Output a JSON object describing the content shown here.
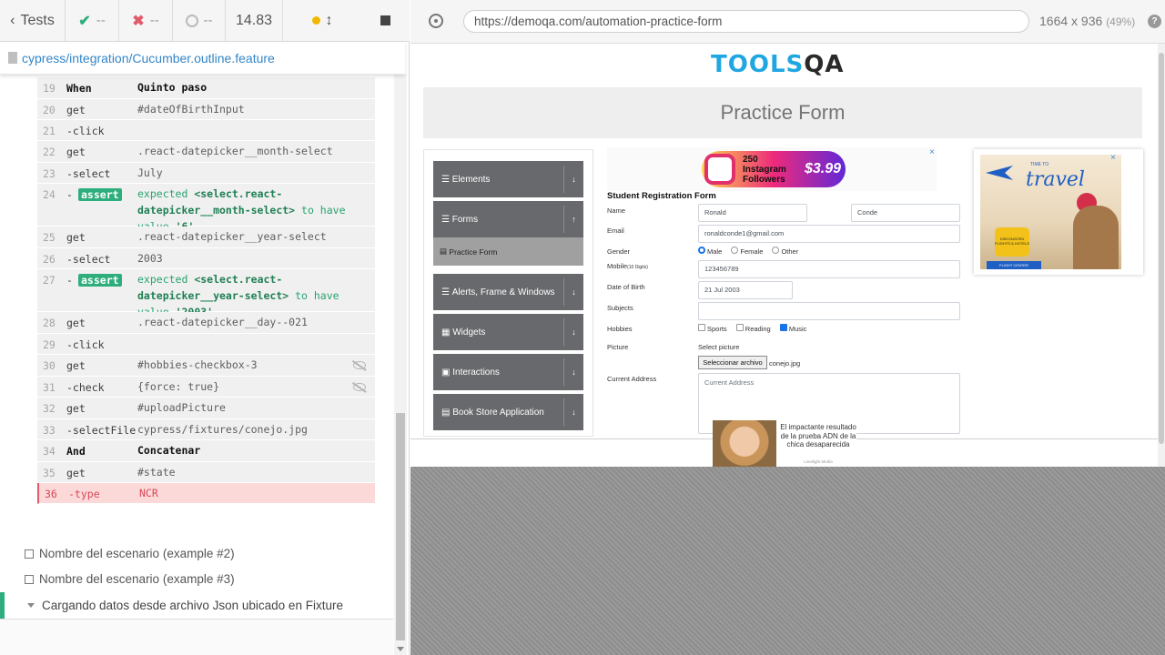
{
  "reporter": {
    "header": {
      "back_label": "Tests",
      "passed": "--",
      "failed": "--",
      "pending": "--",
      "duration": "14.83"
    },
    "file_path": "cypress/integration/Cucumber.outline.feature",
    "commands": [
      {
        "num": "19",
        "name": "When",
        "msg": "Quinto paso",
        "type": "step"
      },
      {
        "num": "20",
        "name": "get",
        "msg": "#dateOfBirthInput"
      },
      {
        "num": "21",
        "name": "-click",
        "msg": ""
      },
      {
        "num": "22",
        "name": "get",
        "msg": ".react-datepicker__month-select"
      },
      {
        "num": "23",
        "name": "-select",
        "msg": "July"
      },
      {
        "num": "24",
        "name": "-",
        "badge": "assert",
        "assert": {
          "pre": "expected",
          "subject": "<select.react-datepicker__month-select>",
          "mid": "to have value",
          "value": "'6'"
        }
      },
      {
        "num": "25",
        "name": "get",
        "msg": ".react-datepicker__year-select"
      },
      {
        "num": "26",
        "name": "-select",
        "msg": "2003"
      },
      {
        "num": "27",
        "name": "-",
        "badge": "assert",
        "assert": {
          "pre": "expected",
          "subject": "<select.react-datepicker__year-select>",
          "mid": "to have value",
          "value": "'2003'"
        }
      },
      {
        "num": "28",
        "name": "get",
        "msg": ".react-datepicker__day--021"
      },
      {
        "num": "29",
        "name": "-click",
        "msg": ""
      },
      {
        "num": "30",
        "name": "get",
        "msg": "#hobbies-checkbox-3",
        "hidden": true
      },
      {
        "num": "31",
        "name": "-check",
        "msg": "{force: true}",
        "hidden": true
      },
      {
        "num": "32",
        "name": "get",
        "msg": "#uploadPicture"
      },
      {
        "num": "33",
        "name": "-selectFile",
        "msg": "cypress/fixtures/conejo.jpg"
      },
      {
        "num": "34",
        "name": "And",
        "msg": "Concatenar",
        "type": "step"
      },
      {
        "num": "35",
        "name": "get",
        "msg": "#state"
      },
      {
        "num": "36",
        "name": "-type",
        "msg": "NCR",
        "type": "err"
      }
    ],
    "scenarios": [
      "Nombre del escenario (example #2)",
      "Nombre del escenario (example #3)"
    ],
    "active_scenario": "Cargando datos desde archivo Json ubicado en Fixture"
  },
  "aut": {
    "url": "https://demoqa.com/automation-practice-form",
    "viewport": "1664 x 936",
    "zoom": "(49%)",
    "page": {
      "logo_a": "TOOLS",
      "logo_b": "QA",
      "banner": "Practice Form",
      "menu": [
        {
          "label": "Elements",
          "arrow": "↓"
        },
        {
          "label": "Forms",
          "arrow": "↑"
        },
        {
          "label": "Alerts, Frame & Windows",
          "arrow": "↓"
        },
        {
          "label": "Widgets",
          "arrow": "↓"
        },
        {
          "label": "Interactions",
          "arrow": "↓"
        },
        {
          "label": "Book Store Application",
          "arrow": "↓"
        }
      ],
      "submenu_active": "Practice Form",
      "ad_top_text": "250 Instagram Followers",
      "ad_top_price": "$3.99",
      "form_title": "Student Registration Form",
      "labels": {
        "name": "Name",
        "email": "Email",
        "gender": "Gender",
        "mobile": "Mobile",
        "mobile_hint": "(10 Digits)",
        "dob": "Date of Birth",
        "subjects": "Subjects",
        "hobbies": "Hobbies",
        "picture": "Picture",
        "address": "Current Address"
      },
      "values": {
        "first_name": "Ronald",
        "last_name": "Conde",
        "email": "ronaldconde1@gmail.com",
        "mobile": "123456789",
        "dob": "21 Jul 2003",
        "file_name": "conejo.jpg"
      },
      "gender_options": [
        "Male",
        "Female",
        "Other"
      ],
      "hobby_options": [
        "Sports",
        "Reading",
        "Music"
      ],
      "select_picture_label": "Select picture",
      "file_button": "Seleccionar archivo",
      "address_placeholder": "Current Address",
      "ad_travel": {
        "line1": "TIME TO",
        "line2": "travel",
        "promo": "DISCOUNTED FLIGHTS & HOTELS",
        "brand": "FLIGHT CENTER"
      },
      "ad_news": {
        "text": "El impactante resultado de la prueba ADN de la chica desaparecida",
        "source": "Limelight Media"
      }
    }
  }
}
